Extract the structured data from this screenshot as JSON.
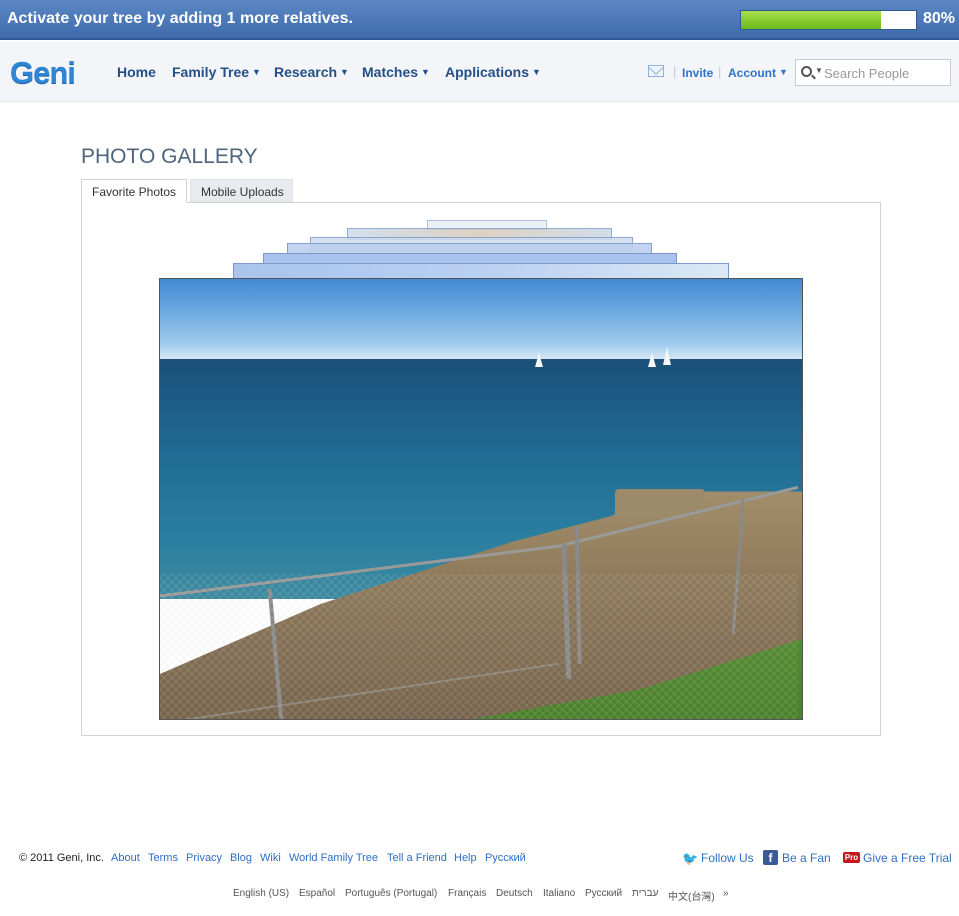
{
  "banner": {
    "text": "Activate your tree by adding 1 more relatives.",
    "progress": 0.8,
    "progress_label": "80%"
  },
  "nav": {
    "logo": "Geni",
    "items": [
      "Home",
      "Family Tree",
      "Research",
      "Matches",
      "Applications"
    ],
    "invite": "Invite",
    "account": "Account",
    "search_placeholder": "Search People"
  },
  "gallery": {
    "title": "PHOTO GALLERY",
    "tabs": [
      "Favorite Photos",
      "Mobile Uploads"
    ],
    "active_tab": "Favorite Photos"
  },
  "footer": {
    "copyright": "© 2011 Geni, Inc.",
    "links": [
      "About",
      "Terms",
      "Privacy",
      "Blog",
      "Wiki",
      "World Family Tree",
      "Tell a Friend",
      "Help",
      "Русский"
    ],
    "social": {
      "follow": "Follow Us",
      "fan": "Be a Fan",
      "pro_badge": "Pro",
      "trial": "Give a Free Trial"
    },
    "languages": [
      "English (US)",
      "Español",
      "Português (Portugal)",
      "Français",
      "Deutsch",
      "Italiano",
      "Русский",
      "עברית",
      "中文(台灣)",
      "»"
    ]
  },
  "colors": {
    "banner": "#4a78b8",
    "progress_fill": "#8ccc30",
    "link": "#2f6fc4",
    "nav_text": "#244f86"
  }
}
